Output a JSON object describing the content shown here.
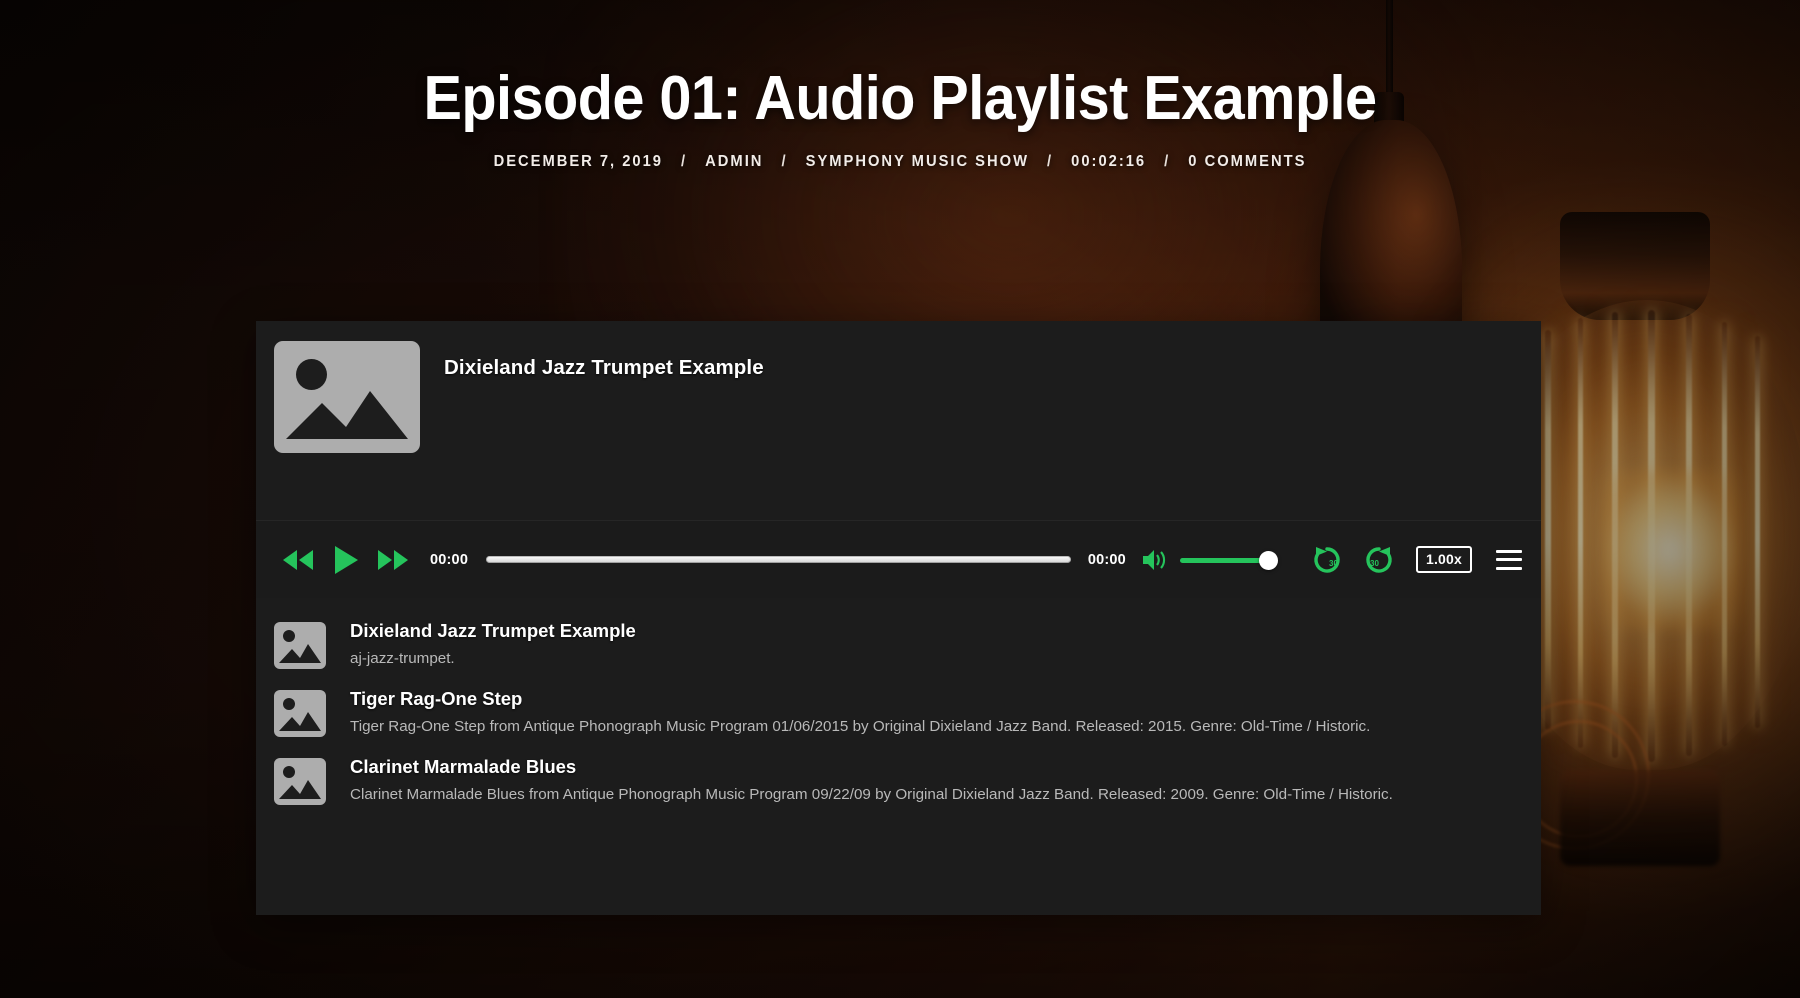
{
  "header": {
    "title": "Episode 01: Audio Playlist Example",
    "meta": [
      {
        "label": "DECEMBER 7, 2019",
        "name": "post-date"
      },
      {
        "label": "ADMIN",
        "name": "post-author"
      },
      {
        "label": "SYMPHONY MUSIC SHOW",
        "name": "post-category"
      },
      {
        "label": "00:02:16",
        "name": "post-duration"
      },
      {
        "label": "0 COMMENTS",
        "name": "post-comments"
      }
    ],
    "separator": "/"
  },
  "player": {
    "now_playing_title": "Dixieland Jazz Trumpet Example",
    "thumbnail_icon": "image-placeholder-icon",
    "controls": {
      "rewind_icon": "rewind-icon",
      "play_icon": "play-icon",
      "fast_forward_icon": "fast-forward-icon",
      "current_time": "00:00",
      "total_time": "00:00",
      "progress_percent": 0,
      "volume_icon": "volume-high-icon",
      "volume_percent": 100,
      "skip_back_icon": "replay-30-icon",
      "skip_back_seconds": "30",
      "skip_forward_icon": "forward-30-icon",
      "skip_forward_seconds": "30",
      "speed_label": "1.00x",
      "menu_icon": "hamburger-menu-icon"
    },
    "accent_color": "#25c45c",
    "panel_color": "#1c1c1c",
    "playlist": [
      {
        "title": "Dixieland Jazz Trumpet Example",
        "description": "aj-jazz-trumpet.",
        "thumbnail_icon": "image-placeholder-icon"
      },
      {
        "title": "Tiger Rag-One Step",
        "description": "Tiger Rag-One Step from Antique Phonograph Music Program 01/06/2015 by Original Dixieland Jazz Band. Released: 2015. Genre: Old-Time / Historic.",
        "thumbnail_icon": "image-placeholder-icon"
      },
      {
        "title": "Clarinet Marmalade Blues",
        "description": "Clarinet Marmalade Blues from Antique Phonograph Music Program 09/22/09 by Original Dixieland Jazz Band. Released: 2009. Genre: Old-Time / Historic.",
        "thumbnail_icon": "image-placeholder-icon"
      }
    ]
  }
}
